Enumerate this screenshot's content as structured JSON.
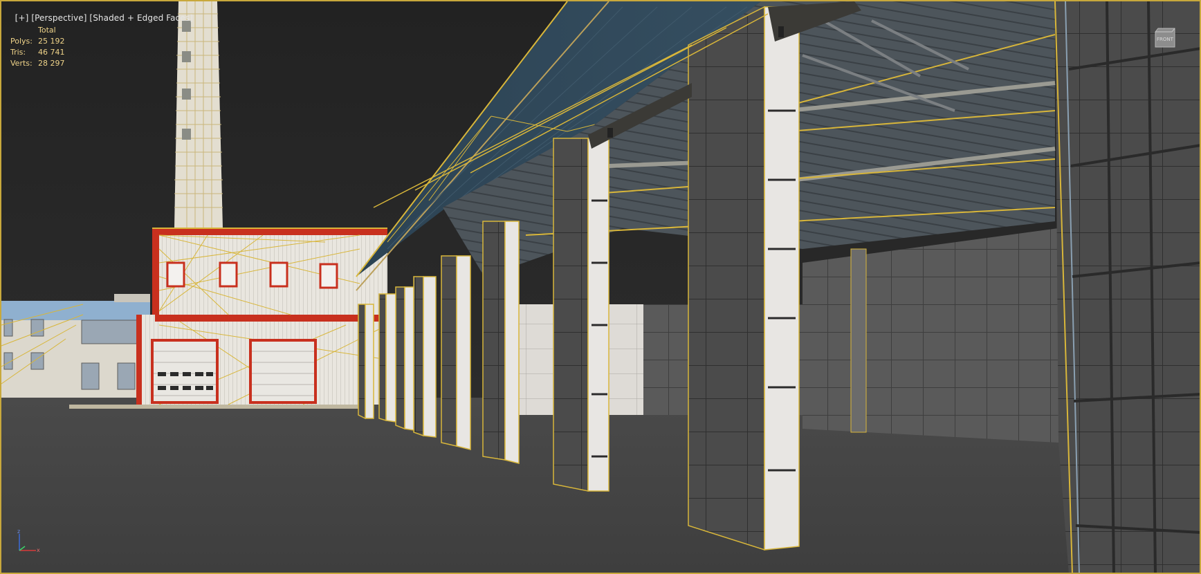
{
  "viewport": {
    "label_bracket_plus": "[+]",
    "label_view": "[Perspective]",
    "label_shading": "[Shaded + Edged Faces]"
  },
  "stats": {
    "header": "Total",
    "rows": [
      {
        "key": "Polys:",
        "value": "25 192"
      },
      {
        "key": "Tris:",
        "value": "46 741"
      },
      {
        "key": "Verts:",
        "value": "28 297"
      }
    ]
  },
  "viewcube": {
    "label": "FRONT",
    "icon": "viewcube-icon"
  },
  "axis_tripod": {
    "x": "x",
    "z": "z",
    "icon": "axis-tripod-icon"
  },
  "colors": {
    "selection_edge": "#d8b63a",
    "viewport_border": "#c8a83c",
    "background": "#1e1e1e",
    "ground": "#3a3a3a",
    "trim_red": "#c8301e",
    "wall_white": "#e8e4dc",
    "roof_blue": "#2e4352",
    "column_dark": "#4a4a4a"
  }
}
